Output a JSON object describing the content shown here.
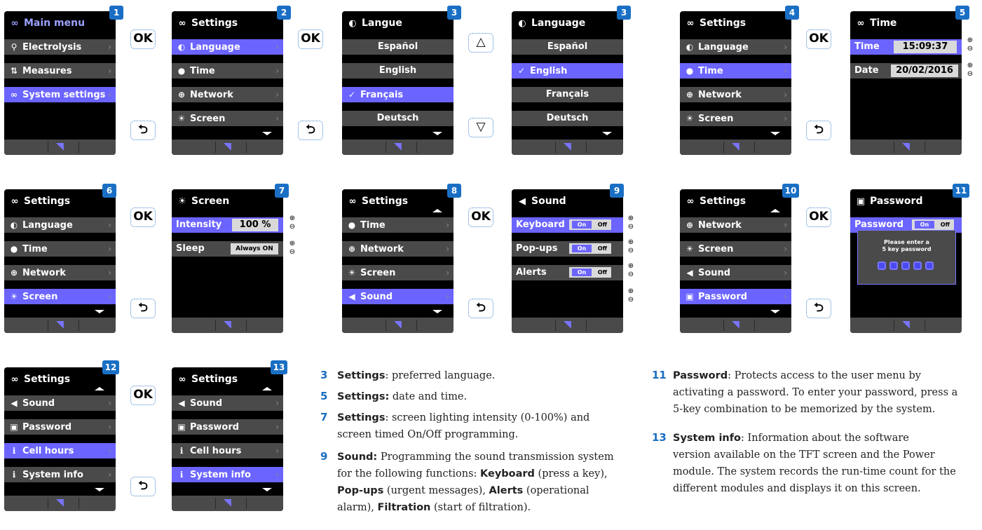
{
  "accent": "#6b64ff",
  "badge_color": "#1a6fc4",
  "screens": {
    "s1": {
      "badge": "1",
      "title": "Main menu",
      "title_icon": "ⴰ",
      "rows": [
        "Electrolysis",
        "Measures",
        "System settings"
      ]
    },
    "s2": {
      "badge": "2",
      "title": "Settings",
      "rows": [
        "Language",
        "Time",
        "Network",
        "Screen"
      ]
    },
    "s3a": {
      "badge": "3",
      "title": "Langue",
      "rows": [
        "Español",
        "English",
        "Français",
        "Deutsch"
      ]
    },
    "s3b": {
      "badge": "3",
      "title": "Language",
      "rows": [
        "Español",
        "English",
        "Français",
        "Deutsch"
      ]
    },
    "s4": {
      "badge": "4",
      "title": "Settings",
      "rows": [
        "Language",
        "Time",
        "Network",
        "Screen"
      ]
    },
    "s5": {
      "badge": "5",
      "title": "Time",
      "rows": [
        "Time",
        "Date"
      ],
      "time": "15:09:37",
      "date": "20/02/2016"
    },
    "s6": {
      "badge": "6",
      "title": "Settings",
      "rows": [
        "Language",
        "Time",
        "Network",
        "Screen"
      ]
    },
    "s7": {
      "badge": "7",
      "title": "Screen",
      "rows": [
        "Intensity",
        "Sleep"
      ],
      "intensity": "100 %",
      "sleep": "Always ON"
    },
    "s8": {
      "badge": "8",
      "title": "Settings",
      "rows": [
        "Time",
        "Network",
        "Screen",
        "Sound"
      ]
    },
    "s9": {
      "badge": "9",
      "title": "Sound",
      "rows": [
        "Keyboard",
        "Pop-ups",
        "Alerts"
      ],
      "on": "On",
      "off": "Off"
    },
    "s10": {
      "badge": "10",
      "title": "Settings",
      "rows": [
        "Network",
        "Screen",
        "Sound",
        "Password"
      ]
    },
    "s11": {
      "badge": "11",
      "title": "Password",
      "rows": [
        "Password"
      ],
      "on": "On",
      "off": "Off",
      "prompt1": "Please enter a",
      "prompt2": "5 key password"
    },
    "s12": {
      "badge": "12",
      "title": "Settings",
      "rows": [
        "Sound",
        "Password",
        "Cell hours",
        "System info"
      ]
    },
    "s13": {
      "badge": "13",
      "title": "Settings",
      "rows": [
        "Sound",
        "Password",
        "Cell hours",
        "System info"
      ]
    }
  },
  "buttons": {
    "ok": "OK",
    "back": "⮌",
    "up": "△",
    "down": "▽",
    "plus": "⊕",
    "minus": "⊖"
  },
  "descriptions": {
    "d3": {
      "num": "3",
      "title": "Settings",
      "text": ": preferred language."
    },
    "d5": {
      "num": "5",
      "title": "Settings:",
      "text": " date and time."
    },
    "d7": {
      "num": "7",
      "title": "Settings",
      "text1": ": screen lighting intensity (0-100%) and",
      "text2": "screen timed On/Off programming."
    },
    "d9": {
      "num": "9",
      "title": "Sound:",
      "text1": " Programming the sound transmission system",
      "text2a": "for the following functions: ",
      "kw1": "Keyboard",
      "text2b": " (press a key),",
      "kw2": "Pop-ups",
      "text3a": " (urgent messages), ",
      "kw3": "Alerts",
      "text3b": " (operational",
      "text4a": "alarm), ",
      "kw4": "Filtration",
      "text4b": " (start of filtration)."
    },
    "d11": {
      "num": "11",
      "title": "Password",
      "text1": ": Protects access to the user menu by",
      "text2": "activating a password. To enter your password, press a",
      "text3": "5-key combination to be memorized by the system."
    },
    "d13": {
      "num": "13",
      "title": "System info",
      "text1": ": Information about the software",
      "text2": "version available on the TFT screen and the Power",
      "text3": "module. The system records the run-time count for the",
      "text4": "different modules and displays it on this screen."
    }
  }
}
